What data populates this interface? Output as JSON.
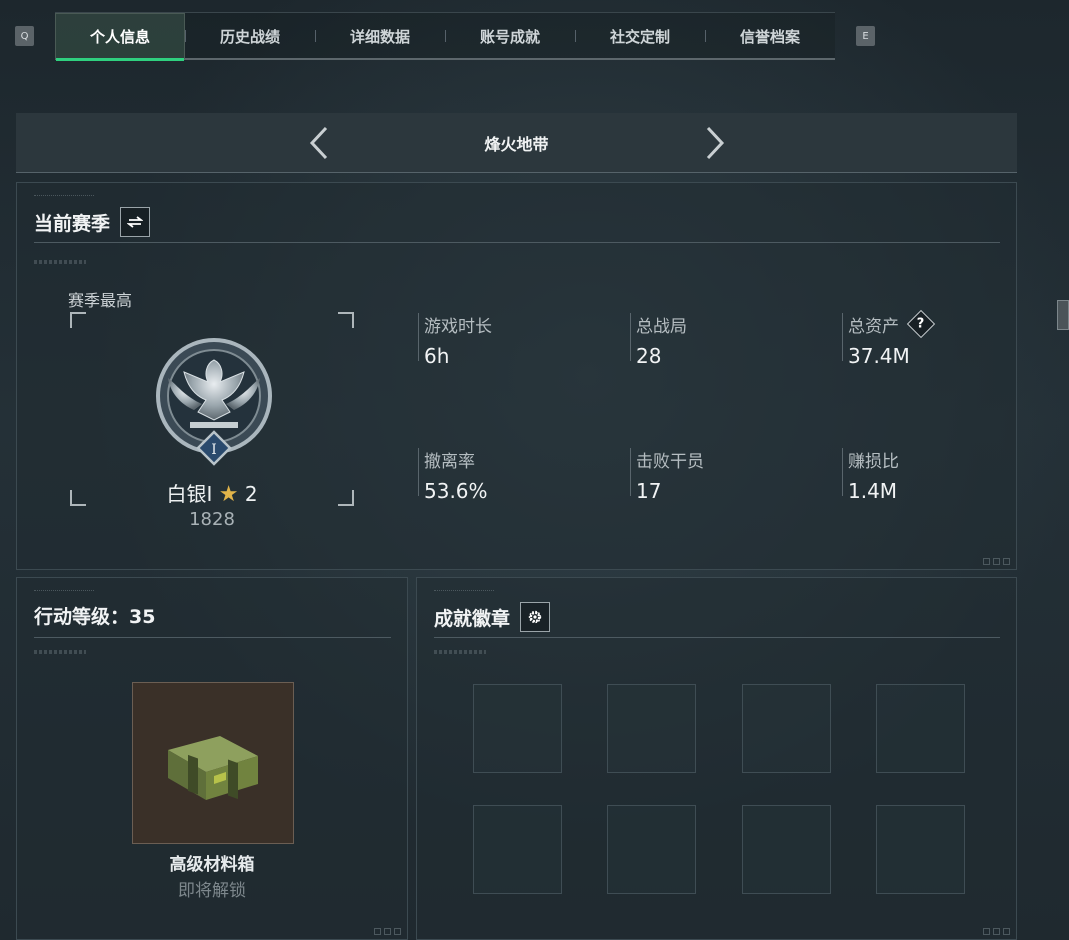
{
  "tabs": {
    "left_key": "Q",
    "right_key": "E",
    "items": [
      {
        "label": "个人信息"
      },
      {
        "label": "历史战绩"
      },
      {
        "label": "详细数据"
      },
      {
        "label": "账号成就"
      },
      {
        "label": "社交定制"
      },
      {
        "label": "信誉档案"
      }
    ],
    "active_index": 0
  },
  "mode_selector": {
    "title": "烽火地带"
  },
  "season_panel": {
    "title": "当前赛季",
    "switch_icon": "swap-arrows-icon",
    "highest_label": "赛季最高",
    "rank_name": "白银I",
    "rank_stars": "2",
    "rank_score": "1828",
    "emblem_numeral": "I",
    "stats": [
      {
        "label": "游戏时长",
        "value": "6h"
      },
      {
        "label": "总战局",
        "value": "28"
      },
      {
        "label": "总资产",
        "value": "37.4M",
        "help": "?"
      },
      {
        "label": "撤离率",
        "value": "53.6%"
      },
      {
        "label": "击败干员",
        "value": "17"
      },
      {
        "label": "赚损比",
        "value": "1.4M"
      }
    ]
  },
  "level_panel": {
    "title": "行动等级：35",
    "reward_name": "高级材料箱",
    "reward_status": "即将解锁"
  },
  "achievement_panel": {
    "title": "成就徽章",
    "settings_icon": "gear-icon",
    "slot_count": 8
  },
  "colors": {
    "accent_green": "#2fd07f",
    "gold_star": "#e1b44a"
  }
}
